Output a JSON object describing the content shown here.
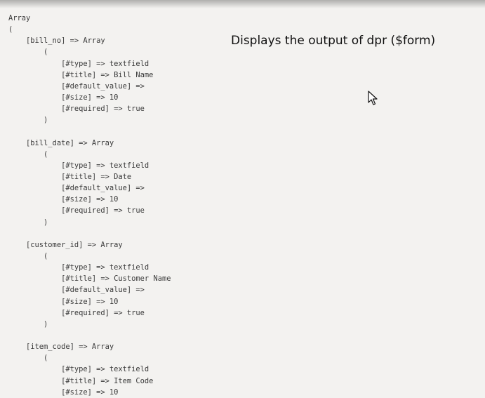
{
  "caption": {
    "text": "Displays the output of dpr ($form)"
  },
  "cursor": {
    "icon": "arrow-pointer-icon"
  },
  "dump": {
    "lines": [
      "Array",
      "(",
      "    [bill_no] => Array",
      "        (",
      "            [#type] => textfield",
      "            [#title] => Bill Name",
      "            [#default_value] =>",
      "            [#size] => 10",
      "            [#required] => true",
      "        )",
      "",
      "    [bill_date] => Array",
      "        (",
      "            [#type] => textfield",
      "            [#title] => Date",
      "            [#default_value] =>",
      "            [#size] => 10",
      "            [#required] => true",
      "        )",
      "",
      "    [customer_id] => Array",
      "        (",
      "            [#type] => textfield",
      "            [#title] => Customer Name",
      "            [#default_value] =>",
      "            [#size] => 10",
      "            [#required] => true",
      "        )",
      "",
      "    [item_code] => Array",
      "        (",
      "            [#type] => textfield",
      "            [#title] => Item Code",
      "            [#size] => 10"
    ]
  }
}
